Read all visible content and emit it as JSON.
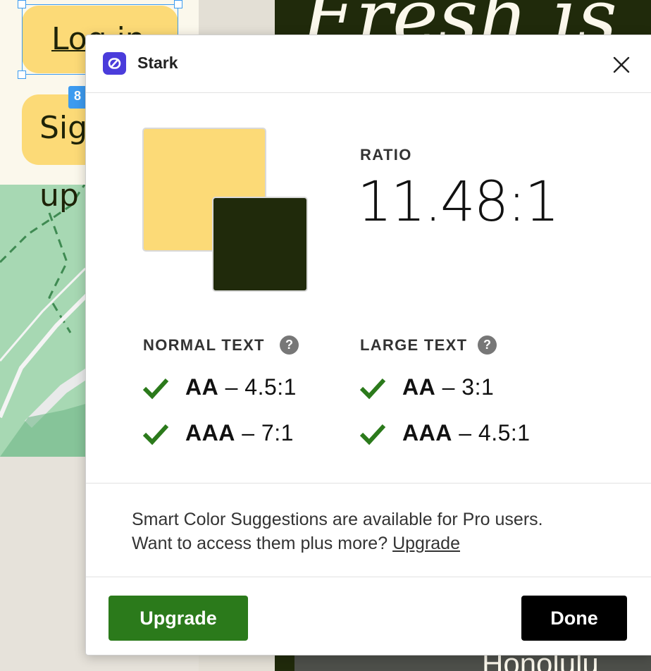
{
  "canvas": {
    "login_button_label": "Log in",
    "signup_button_label": "Sign up",
    "selection_badge": "8",
    "script_heading": "Fresh is",
    "location_label": "Honolulu"
  },
  "dialog": {
    "title": "Stark",
    "foreground_color": "#fcda77",
    "background_color": "#202a0b",
    "ratio_label": "RATIO",
    "ratio_value": "11.48:1",
    "normal_text": {
      "label": "NORMAL TEXT",
      "help": "?",
      "levels": [
        {
          "name": "AA",
          "requirement": "– 4.5:1",
          "passed": true
        },
        {
          "name": "AAA",
          "requirement": "– 7:1",
          "passed": true
        }
      ]
    },
    "large_text": {
      "label": "LARGE TEXT",
      "help": "?",
      "levels": [
        {
          "name": "AA",
          "requirement": "– 3:1",
          "passed": true
        },
        {
          "name": "AAA",
          "requirement": "– 4.5:1",
          "passed": true
        }
      ]
    },
    "promo_line1": "Smart Color Suggestions are available for Pro users.",
    "promo_line2": "Want to access them plus more?",
    "promo_link": "Upgrade",
    "upgrade_button": "Upgrade",
    "done_button": "Done",
    "accent_color": "#2b7a1b",
    "brand_color": "#4a3cdb"
  }
}
